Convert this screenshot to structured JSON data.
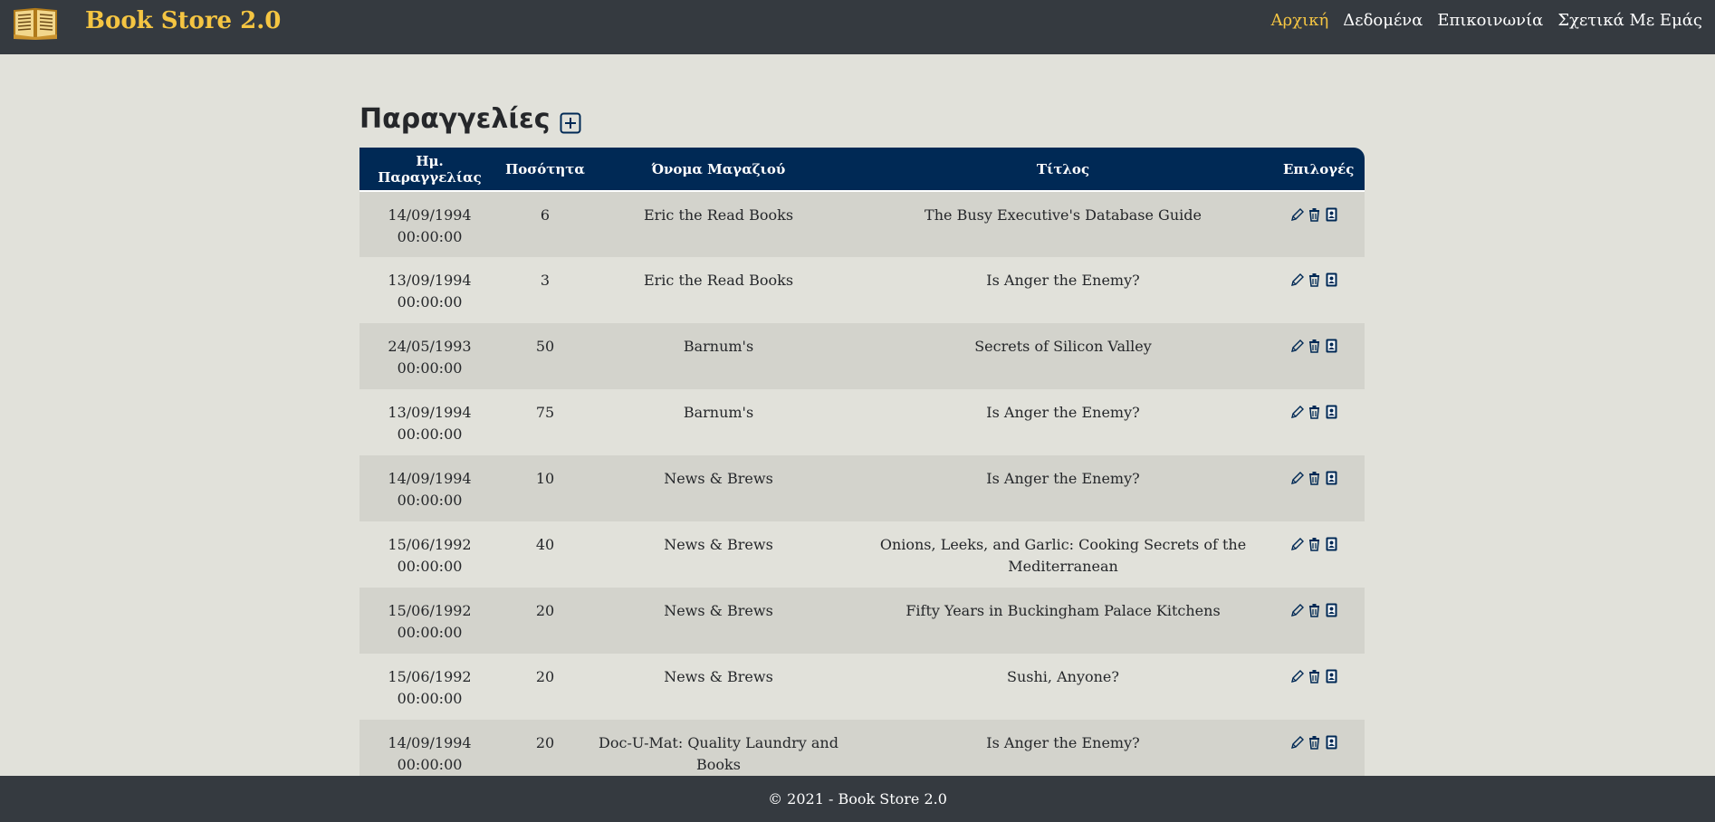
{
  "navbar": {
    "logo_icon": "open-book-icon",
    "brand": "Book Store 2.0",
    "links": [
      {
        "label": "Αρχική",
        "active": true
      },
      {
        "label": "Δεδομένα",
        "active": false
      },
      {
        "label": "Επικοινωνία",
        "active": false
      },
      {
        "label": "Σχετικά Με Εμάς",
        "active": false
      }
    ],
    "active_color": "#f5c542"
  },
  "main": {
    "heading": "Παραγγελίες",
    "add_icon": "plus-square-icon"
  },
  "table": {
    "headers": [
      "Ημ. Παραγγελίας",
      "Ποσότητα",
      "Όνομα Μαγαζιού",
      "Τίτλος",
      "Επιλογές"
    ],
    "rows": [
      {
        "date": "14/09/1994",
        "time": "00:00:00",
        "qty": "6",
        "store": "Eric the Read Books",
        "title": "The Busy Executive's Database Guide"
      },
      {
        "date": "13/09/1994",
        "time": "00:00:00",
        "qty": "3",
        "store": "Eric the Read Books",
        "title": "Is Anger the Enemy?"
      },
      {
        "date": "24/05/1993",
        "time": "00:00:00",
        "qty": "50",
        "store": "Barnum's",
        "title": "Secrets of Silicon Valley"
      },
      {
        "date": "13/09/1994",
        "time": "00:00:00",
        "qty": "75",
        "store": "Barnum's",
        "title": "Is Anger the Enemy?"
      },
      {
        "date": "14/09/1994",
        "time": "00:00:00",
        "qty": "10",
        "store": "News & Brews",
        "title": "Is Anger the Enemy?"
      },
      {
        "date": "15/06/1992",
        "time": "00:00:00",
        "qty": "40",
        "store": "News & Brews",
        "title": "Onions, Leeks, and Garlic: Cooking Secrets of the Mediterranean"
      },
      {
        "date": "15/06/1992",
        "time": "00:00:00",
        "qty": "20",
        "store": "News & Brews",
        "title": "Fifty Years in Buckingham Palace Kitchens"
      },
      {
        "date": "15/06/1992",
        "time": "00:00:00",
        "qty": "20",
        "store": "News & Brews",
        "title": "Sushi, Anyone?"
      },
      {
        "date": "14/09/1994",
        "time": "00:00:00",
        "qty": "20",
        "store": "Doc-U-Mat: Quality Laundry and Books",
        "title": "Is Anger the Enemy?"
      }
    ],
    "action_icons": [
      "pencil-icon",
      "trash-icon",
      "contact-book-icon"
    ],
    "header_color": "#002955"
  },
  "footer": {
    "text": "© 2021 - Book Store 2.0"
  }
}
